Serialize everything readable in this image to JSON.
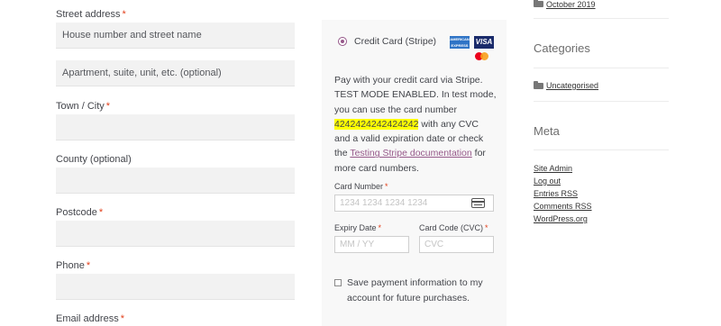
{
  "billing": {
    "street_label": "Street address",
    "street_placeholder_1": "House number and street name",
    "street_placeholder_2": "Apartment, suite, unit, etc. (optional)",
    "town_label": "Town / City",
    "county_label": "County (optional)",
    "postcode_label": "Postcode",
    "phone_label": "Phone",
    "email_label": "Email address",
    "required_mark": "*"
  },
  "payment": {
    "method_label": "Credit Card (Stripe)",
    "card_brands": [
      "American Express",
      "VISA",
      "Mastercard"
    ],
    "amex_text": "AMERICAN EXPRESS",
    "visa_text": "VISA",
    "description_before": "Pay with your credit card via Stripe. TEST MODE ENABLED. In test mode, you can use the card number ",
    "test_card_number": "4242424242424242",
    "description_middle": " with any CVC and a valid expiration date or check the ",
    "docs_link": "Testing Stripe documentation",
    "description_after": " for more card numbers.",
    "card_number_label": "Card Number",
    "card_number_placeholder": "1234 1234 1234 1234",
    "expiry_label": "Expiry Date",
    "expiry_placeholder": "MM / YY",
    "cvc_label": "Card Code (CVC)",
    "cvc_placeholder": "CVC",
    "save_info_label": "Save payment information to my account for future purchases.",
    "accent_color": "#96588a",
    "highlight_color": "#ffff00"
  },
  "sidebar": {
    "archive_link": "October 2019",
    "categories_heading": "Categories",
    "category_link": "Uncategorised",
    "meta_heading": "Meta",
    "meta_links": [
      "Site Admin",
      "Log out",
      "Entries RSS",
      "Comments RSS",
      "WordPress.org"
    ]
  }
}
